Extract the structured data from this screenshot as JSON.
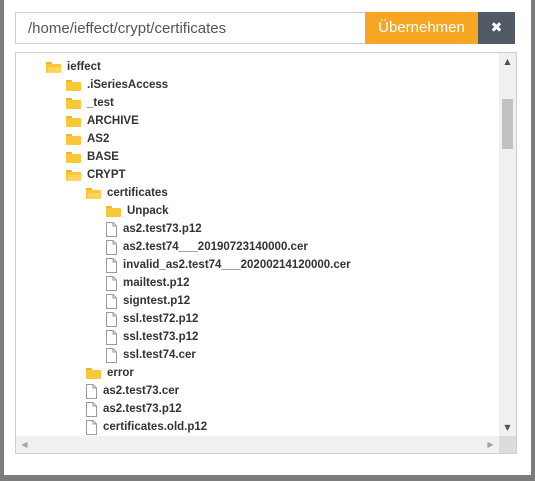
{
  "pathbar": {
    "path_value": "/home/ieffect/crypt/certificates",
    "apply_label": "Übernehmen",
    "close_label": "✖"
  },
  "tree": {
    "rows": [
      {
        "type": "folder-open",
        "depth": 0,
        "label": "ieffect"
      },
      {
        "type": "folder",
        "depth": 1,
        "label": ".iSeriesAccess"
      },
      {
        "type": "folder",
        "depth": 1,
        "label": "_test"
      },
      {
        "type": "folder",
        "depth": 1,
        "label": "ARCHIVE"
      },
      {
        "type": "folder",
        "depth": 1,
        "label": "AS2"
      },
      {
        "type": "folder",
        "depth": 1,
        "label": "BASE"
      },
      {
        "type": "folder-open",
        "depth": 1,
        "label": "CRYPT"
      },
      {
        "type": "folder-open",
        "depth": 2,
        "label": "certificates"
      },
      {
        "type": "folder",
        "depth": 3,
        "label": "Unpack"
      },
      {
        "type": "file",
        "depth": 3,
        "label": "as2.test73.p12"
      },
      {
        "type": "file",
        "depth": 3,
        "label": "as2.test74___20190723140000.cer"
      },
      {
        "type": "file",
        "depth": 3,
        "label": "invalid_as2.test74___20200214120000.cer"
      },
      {
        "type": "file",
        "depth": 3,
        "label": "mailtest.p12"
      },
      {
        "type": "file",
        "depth": 3,
        "label": "signtest.p12"
      },
      {
        "type": "file",
        "depth": 3,
        "label": "ssl.test72.p12"
      },
      {
        "type": "file",
        "depth": 3,
        "label": "ssl.test73.p12"
      },
      {
        "type": "file",
        "depth": 3,
        "label": "ssl.test74.cer"
      },
      {
        "type": "folder",
        "depth": 2,
        "label": "error"
      },
      {
        "type": "file",
        "depth": 2,
        "label": "as2.test73.cer"
      },
      {
        "type": "file",
        "depth": 2,
        "label": "as2.test73.p12"
      },
      {
        "type": "file",
        "depth": 2,
        "label": "certificates.old.p12"
      }
    ]
  },
  "colors": {
    "accent": "#f5a623",
    "close_bg": "#505a64",
    "folder": "#f9c838"
  }
}
